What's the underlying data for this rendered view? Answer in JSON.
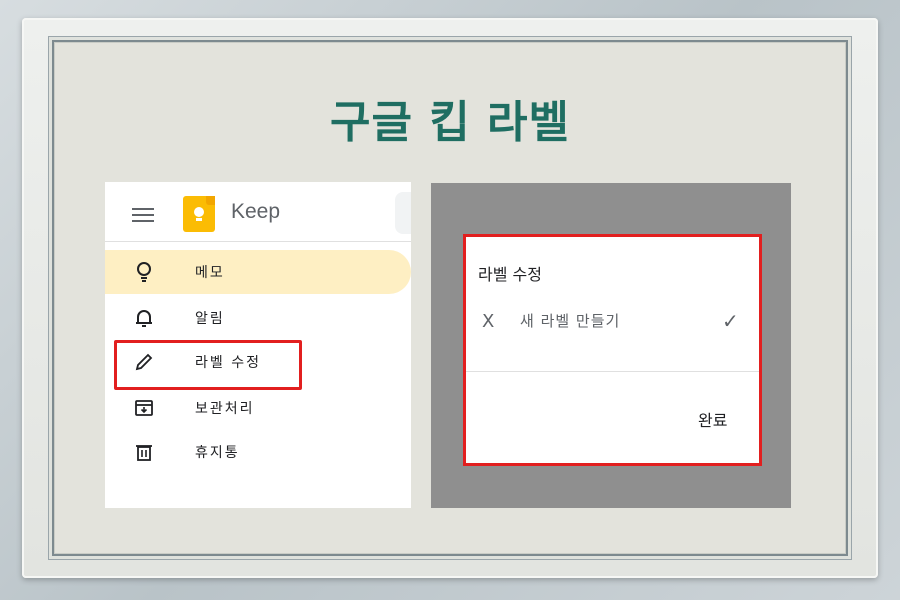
{
  "title": "구글 킵 라벨",
  "keep": {
    "app_name": "Keep",
    "nav": [
      {
        "label": "메모",
        "icon": "lightbulb-icon",
        "active": true
      },
      {
        "label": "알림",
        "icon": "bell-icon",
        "active": false
      },
      {
        "label": "라벨 수정",
        "icon": "pencil-icon",
        "active": false
      },
      {
        "label": "보관처리",
        "icon": "archive-icon",
        "active": false
      },
      {
        "label": "휴지통",
        "icon": "trash-icon",
        "active": false
      }
    ]
  },
  "dialog": {
    "title": "라벨 수정",
    "close_glyph": "X",
    "input_placeholder": "새 라벨 만들기",
    "check_glyph": "✓",
    "done_label": "완료"
  },
  "colors": {
    "title": "#1f6e62",
    "active_nav": "#feefc3",
    "highlight": "#e21f1f",
    "keep_yellow": "#fbbc04"
  }
}
